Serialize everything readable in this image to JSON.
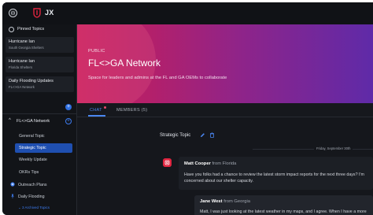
{
  "app": {
    "brand": "JX"
  },
  "sidebar": {
    "pinned_label": "Pinned Topics",
    "pinned": [
      {
        "title": "Hurricane Ian",
        "subtitle": "South Georgia Shelters"
      },
      {
        "title": "Hurricane Ian",
        "subtitle": "Florida Shelters"
      },
      {
        "title": "Daily Flooding Updates",
        "subtitle": "FL<>GA Network"
      }
    ],
    "group": {
      "label": "FL<>GA Network",
      "items": [
        {
          "label": "General Topic"
        },
        {
          "label": "Strategic Topic"
        },
        {
          "label": "Weekly Update"
        },
        {
          "label": "OKRs Tips"
        }
      ]
    },
    "extra": [
      {
        "label": "Outreach Plans",
        "icon": "plus-circle-icon"
      },
      {
        "label": "Daily Flooding",
        "icon": "pin-icon"
      }
    ],
    "archived": "3 Archived Topics"
  },
  "banner": {
    "visibility": "PUBLIC",
    "title": "FL<>GA Network",
    "description": "Space for leaders and admins at the FL and GA OEMs to collaborate"
  },
  "tabs": {
    "chat": "CHAT",
    "members": "MEMBERS (5)"
  },
  "thread": {
    "title": "Strategic Topic",
    "date": "Friday, September 30th",
    "messages": [
      {
        "name": "Matt Cooper",
        "from": "from Florida",
        "body": "Have you folks had a chance to review the latest storm impact reports for the next three days? I'm concerned about our shelter capacity."
      },
      {
        "name": "Jane West",
        "from": "from Georgia",
        "body": "Matt, I was just looking at the latest weather in my maps, and I agree.  When I have a more"
      }
    ]
  },
  "colors": {
    "accent": "#2f6fe0",
    "banner_start": "#c61f5f",
    "banner_end": "#5f2aa8",
    "avatar": "#e0243f"
  }
}
